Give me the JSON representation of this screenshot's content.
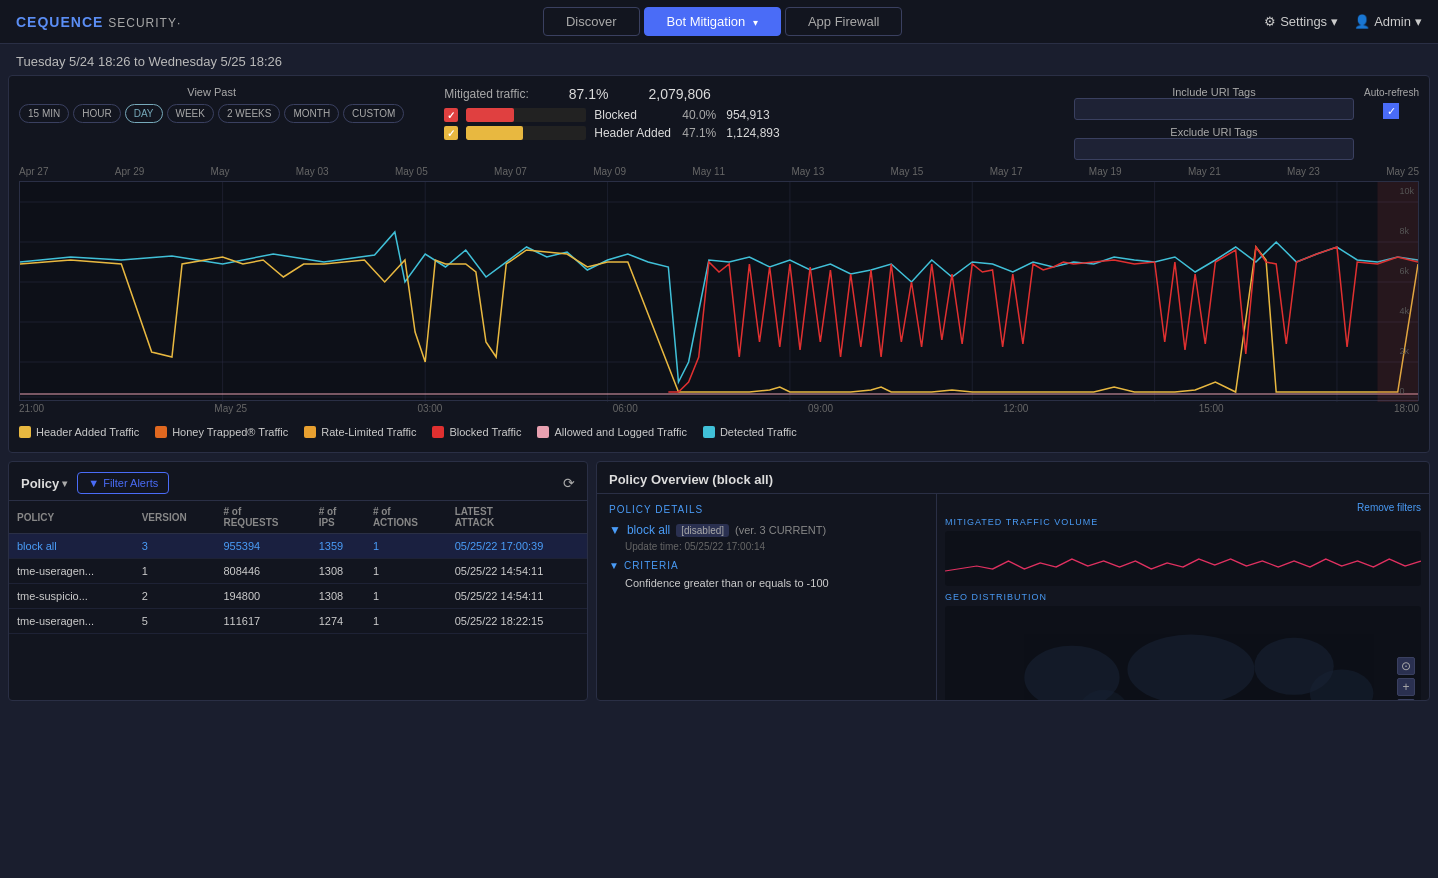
{
  "logo": {
    "brand": "CEQUENCE",
    "subtitle": "SECURITY·"
  },
  "nav": {
    "tabs": [
      {
        "id": "discover",
        "label": "Discover",
        "active": false
      },
      {
        "id": "bot-mitigation",
        "label": "Bot Mitigation",
        "active": true,
        "hasChevron": true
      },
      {
        "id": "app-firewall",
        "label": "App Firewall",
        "active": false
      }
    ],
    "settings_label": "Settings",
    "admin_label": "Admin"
  },
  "date_range": "Tuesday 5/24 18:26 to Wednesday 5/25 18:26",
  "chart": {
    "view_past_label": "View Past",
    "time_buttons": [
      {
        "label": "15 MIN",
        "active": false
      },
      {
        "label": "HOUR",
        "active": false
      },
      {
        "label": "DAY",
        "active": true
      },
      {
        "label": "WEEK",
        "active": false
      },
      {
        "label": "2 WEEKS",
        "active": false
      },
      {
        "label": "MONTH",
        "active": false
      },
      {
        "label": "CUSTOM",
        "active": false
      }
    ],
    "mitigated_label": "Mitigated traffic:",
    "mitigated_pct": "87.1%",
    "mitigated_count": "2,079,806",
    "legend_rows": [
      {
        "id": "blocked",
        "name": "Blocked",
        "pct": "40.0%",
        "count": "954,913",
        "color": "#e04040",
        "bar_pct": 40
      },
      {
        "id": "header",
        "name": "Header Added",
        "pct": "47.1%",
        "count": "1,124,893",
        "color": "#e8b840",
        "bar_pct": 47
      }
    ],
    "include_uri_label": "Include URI Tags",
    "exclude_uri_label": "Exclude URI Tags",
    "auto_refresh_label": "Auto-refresh",
    "date_labels_top": [
      "Apr 27",
      "Apr 29",
      "May",
      "May 03",
      "May 05",
      "May 07",
      "May 09",
      "May 11",
      "May 13",
      "May 15",
      "May 17",
      "May 19",
      "May 21",
      "May 23",
      "May 25"
    ],
    "time_labels_bottom": [
      "21:00",
      "May 25",
      "03:00",
      "06:00",
      "09:00",
      "12:00",
      "15:00",
      "18:00"
    ],
    "y_labels": [
      "10k",
      "8k",
      "6k",
      "4k",
      "2k",
      "0"
    ],
    "legend_items": [
      {
        "label": "Header Added Traffic",
        "color": "#e8b840"
      },
      {
        "label": "Honey Trapped® Traffic",
        "color": "#e06820"
      },
      {
        "label": "Rate-Limited Traffic",
        "color": "#e8a030"
      },
      {
        "label": "Blocked Traffic",
        "color": "#e03030"
      },
      {
        "label": "Allowed and Logged Traffic",
        "color": "#e8a0b0"
      },
      {
        "label": "Detected Traffic",
        "color": "#40c0d8"
      }
    ]
  },
  "policy_panel": {
    "title": "Policy",
    "filter_label": "Filter Alerts",
    "columns": [
      {
        "id": "policy",
        "label": "POLICY"
      },
      {
        "id": "version",
        "label": "VERSION"
      },
      {
        "id": "requests",
        "label": "# of\nREQUESTS"
      },
      {
        "id": "ips",
        "label": "# of\nIPS"
      },
      {
        "id": "actions",
        "label": "# of\nACTIONS"
      },
      {
        "id": "latest_attack",
        "label": "LATEST\nATTACK"
      }
    ],
    "rows": [
      {
        "policy": "block all",
        "version": "3",
        "requests": "955394",
        "ips": "1359",
        "actions": "1",
        "latest_attack": "05/25/22 17:00:39",
        "highlight": true
      },
      {
        "policy": "tme-useragen...",
        "version": "1",
        "requests": "808446",
        "ips": "1308",
        "actions": "1",
        "latest_attack": "05/25/22 14:54:11",
        "highlight": false
      },
      {
        "policy": "tme-suspicio...",
        "version": "2",
        "requests": "194800",
        "ips": "1308",
        "actions": "1",
        "latest_attack": "05/25/22 14:54:11",
        "highlight": false
      },
      {
        "policy": "tme-useragen...",
        "version": "5",
        "requests": "111617",
        "ips": "1274",
        "actions": "1",
        "latest_attack": "05/25/22 18:22:15",
        "highlight": false
      }
    ]
  },
  "overview_panel": {
    "title": "Policy Overview (block all)",
    "remove_filters_label": "Remove filters",
    "policy_details_label": "POLICY DETAILS",
    "policy_name": "block all",
    "policy_tag": "[disabled]",
    "policy_version": "(ver. 3 CURRENT)",
    "update_time": "Update time: 05/25/22 17:00:14",
    "criteria_label": "CRITERIA",
    "criteria_item": "Confidence greater than or equals to -100",
    "mitigated_traffic_label": "MITIGATED TRAFFIC VOLUME",
    "geo_distribution_label": "GEO DISTRIBUTION"
  }
}
